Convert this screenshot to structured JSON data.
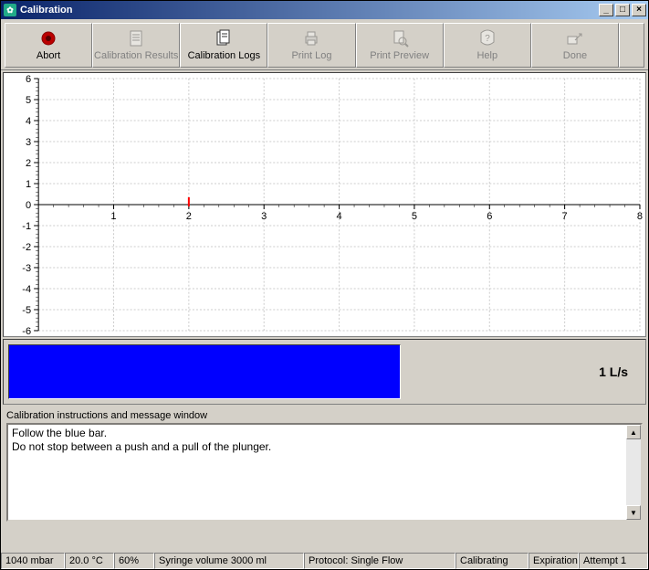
{
  "window": {
    "title": "Calibration"
  },
  "toolbar": {
    "abort": "Abort",
    "results": "Calibration Results",
    "logs": "Calibration Logs",
    "print_log": "Print Log",
    "print_preview": "Print Preview",
    "help": "Help",
    "done": "Done"
  },
  "chart_data": {
    "type": "line",
    "x_range": [
      0,
      8
    ],
    "y_range": [
      -6,
      6
    ],
    "x_ticks": [
      1,
      2,
      3,
      4,
      5,
      6,
      7,
      8
    ],
    "y_ticks": [
      -6,
      -5,
      -4,
      -3,
      -2,
      -1,
      0,
      1,
      2,
      3,
      4,
      5,
      6
    ],
    "marker": {
      "x": 2,
      "y": 0,
      "color": "#ff0000"
    },
    "title": "",
    "xlabel": "",
    "ylabel": ""
  },
  "flow": {
    "rate_label": "1 L/s",
    "bar_fill_percent": 62,
    "bar_color": "#0000ff"
  },
  "messages": {
    "caption": "Calibration instructions and message window",
    "lines": [
      "Follow the blue bar.",
      "Do not stop between a push and a pull of the plunger."
    ]
  },
  "status": {
    "pressure": "1040 mbar",
    "temperature": "20.0 °C",
    "humidity": "60%",
    "syringe": "Syringe volume 3000 ml",
    "protocol": "Protocol: Single Flow",
    "state": "Calibrating",
    "expiration": "Expiration",
    "attempt": "Attempt 1"
  }
}
